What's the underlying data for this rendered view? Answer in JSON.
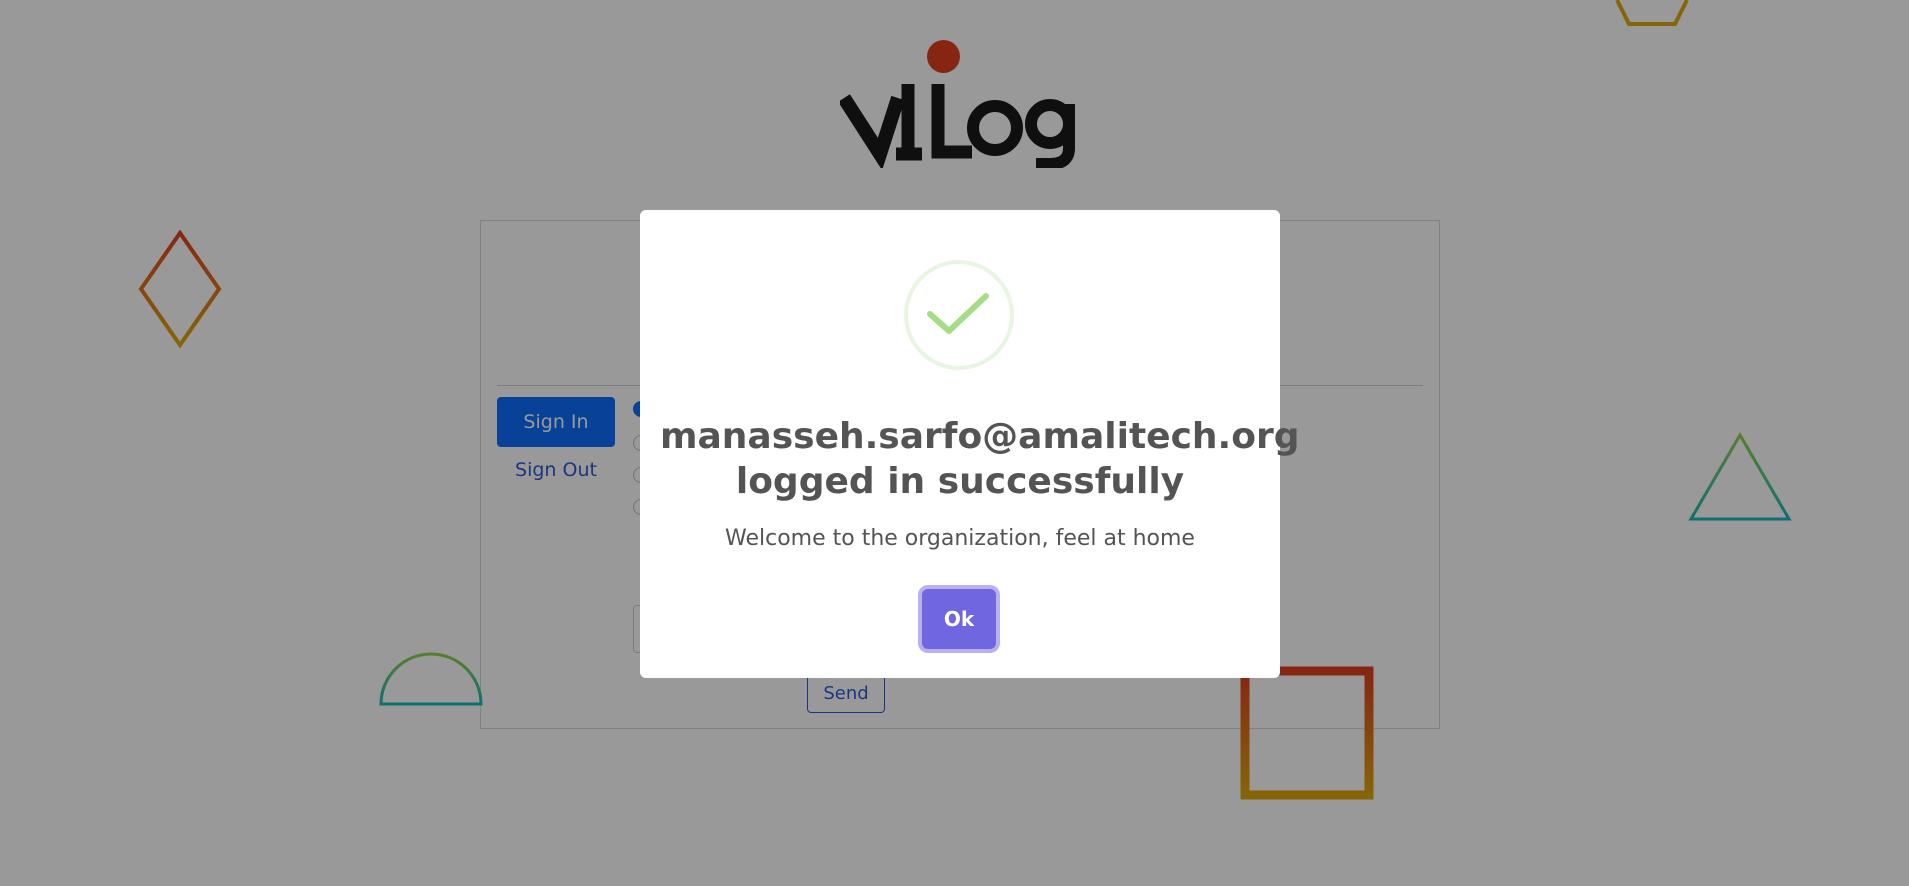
{
  "logo": {
    "text": "ViLog",
    "dot_color": "#e0401f"
  },
  "card": {
    "signin_label": "Sign In",
    "signout_label": "Sign Out",
    "send_label": "Send"
  },
  "modal": {
    "icon": "success-check-icon",
    "title": "manasseh.sarfo@amalitech.org logged in successfully",
    "text": "Welcome to the organization, feel at home",
    "ok_label": "Ok",
    "ok_color": "#7066e0",
    "check_color": "#a5dc86"
  },
  "colors": {
    "primary": "#0d6efd",
    "overlay": "rgba(0,0,0,0.4)"
  }
}
